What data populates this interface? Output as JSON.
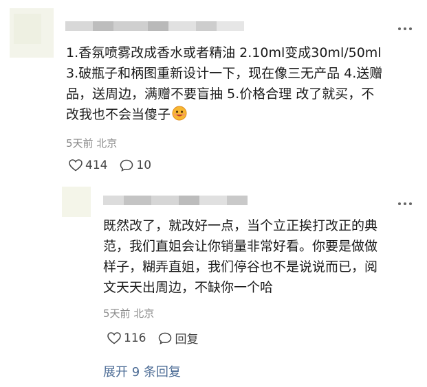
{
  "comment": {
    "text_lines": [
      "1.香氛喷雾改成香水或者精油 2.10ml变成30ml/50ml",
      "3.破瓶子和柄图重新设计一下，现在像三无产品 4.送赠",
      "品，送周边，满赠不要盲抽 5.价格合理 改了就买，不",
      "改我也不会当傻子"
    ],
    "meta": "5天前 北京",
    "likes": "414",
    "replies": "10",
    "emoji_icon": "grinning-face-emoji-icon"
  },
  "reply": {
    "text_lines": [
      "既然改了，就改好一点，当个立正挨打改正的典",
      "范，我们直姐会让你销量非常好看。你要是做做",
      "样子，糊弄直姐，我们停谷也不是说说而已，阅",
      "文天天出周边，不缺你一个哈"
    ],
    "meta": "5天前 北京",
    "likes": "116",
    "reply_label": "回复"
  },
  "expand_label": "展开 9 条回复",
  "more_icon": "⋮",
  "colors": {
    "link": "#4a6a94",
    "meta": "#8a8a8a"
  }
}
